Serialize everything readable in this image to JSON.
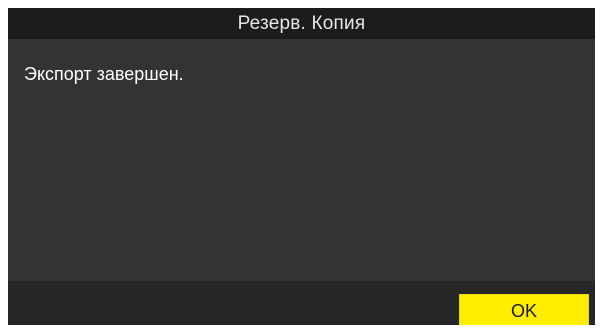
{
  "dialog": {
    "title": "Резерв. Копия",
    "message": "Экспорт завершен.",
    "ok_label": "OK"
  },
  "colors": {
    "title_bar": "#1c1c1c",
    "body": "#333333",
    "footer": "#262626",
    "ok_button": "#ffee00"
  }
}
